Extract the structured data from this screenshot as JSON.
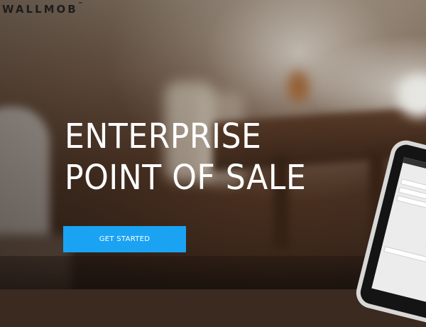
{
  "brand": {
    "name": "WALLMOB",
    "trademark": "™"
  },
  "hero": {
    "headline_line1": "ENTERPRISE",
    "headline_line2": "POINT OF SALE",
    "cta_label": "GET STARTED"
  },
  "colors": {
    "cta_background": "#1aa3f2",
    "headline_text": "#ffffff",
    "logo_text": "#1d1d1d"
  },
  "icons": {
    "tablet": "tablet-device-image"
  }
}
